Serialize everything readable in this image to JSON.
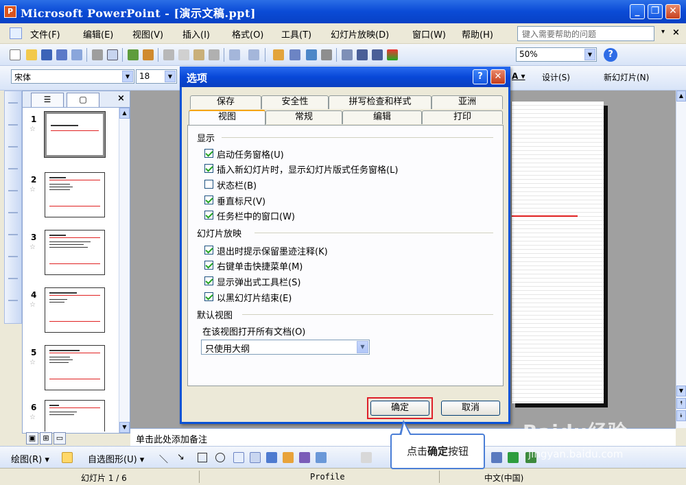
{
  "window": {
    "title": "Microsoft PowerPoint - [演示文稿.ppt]",
    "app_icon": "P"
  },
  "menu": {
    "items": [
      "文件(F)",
      "编辑(E)",
      "视图(V)",
      "插入(I)",
      "格式(O)",
      "工具(T)",
      "幻灯片放映(D)",
      "窗口(W)",
      "帮助(H)"
    ],
    "help_placeholder": "键入需要帮助的问题",
    "close": "×",
    "arrow": "▾"
  },
  "toolbar": {
    "zoom": "50%",
    "help": "?"
  },
  "format_toolbar": {
    "font": "宋体",
    "size": "18",
    "design": "设计(S)",
    "new_slide": "新幻灯片(N)"
  },
  "slide_pane": {
    "tabs": [
      "☰",
      "▢"
    ],
    "close": "×",
    "slides": [
      {
        "num": "1",
        "star": "☆"
      },
      {
        "num": "2",
        "star": "☆"
      },
      {
        "num": "3",
        "star": "☆"
      },
      {
        "num": "4",
        "star": "☆"
      },
      {
        "num": "5",
        "star": "☆"
      },
      {
        "num": "6",
        "star": "☆"
      }
    ]
  },
  "notes": {
    "placeholder": "单击此处添加备注"
  },
  "view_buttons": [
    "▣",
    "⊞",
    "▭"
  ],
  "drawing": {
    "draw": "绘图(R)",
    "autoshapes": "自选图形(U)"
  },
  "status": {
    "slide": "幻灯片 1 / 6",
    "design": "Profile",
    "language": "中文(中国)"
  },
  "dialog": {
    "title": "选项",
    "help": "?",
    "close": "✕",
    "tabs_back": [
      "保存",
      "安全性",
      "拼写检查和样式",
      "亚洲"
    ],
    "tabs_front": [
      "视图",
      "常规",
      "编辑",
      "打印"
    ],
    "groups": {
      "show": {
        "label": "显示",
        "items": [
          {
            "label": "启动任务窗格(U)",
            "checked": true
          },
          {
            "label": "插入新幻灯片时，显示幻灯片版式任务窗格(L)",
            "checked": true
          },
          {
            "label": "状态栏(B)",
            "checked": false
          },
          {
            "label": "垂直标尺(V)",
            "checked": true
          },
          {
            "label": "任务栏中的窗口(W)",
            "checked": true
          }
        ]
      },
      "slideshow": {
        "label": "幻灯片放映",
        "items": [
          {
            "label": "退出时提示保留墨迹注释(K)",
            "checked": true
          },
          {
            "label": "右键单击快捷菜单(M)",
            "checked": true
          },
          {
            "label": "显示弹出式工具栏(S)",
            "checked": true
          },
          {
            "label": "以黑幻灯片结束(E)",
            "checked": true
          }
        ]
      },
      "default_view": {
        "label": "默认视图",
        "open_label": "在该视图打开所有文档(O)",
        "selected": "只使用大纲"
      }
    },
    "ok": "确定",
    "cancel": "取消"
  },
  "callout": {
    "prefix": "点击",
    "bold": "确定",
    "suffix": "按钮"
  },
  "watermark": {
    "brand": "Baidu经验",
    "url": "jingyan.baidu.com"
  },
  "colors": {
    "title_blue": "#0A4BD6",
    "highlight_red": "#E0202A",
    "accent_orange": "#F5A516"
  }
}
